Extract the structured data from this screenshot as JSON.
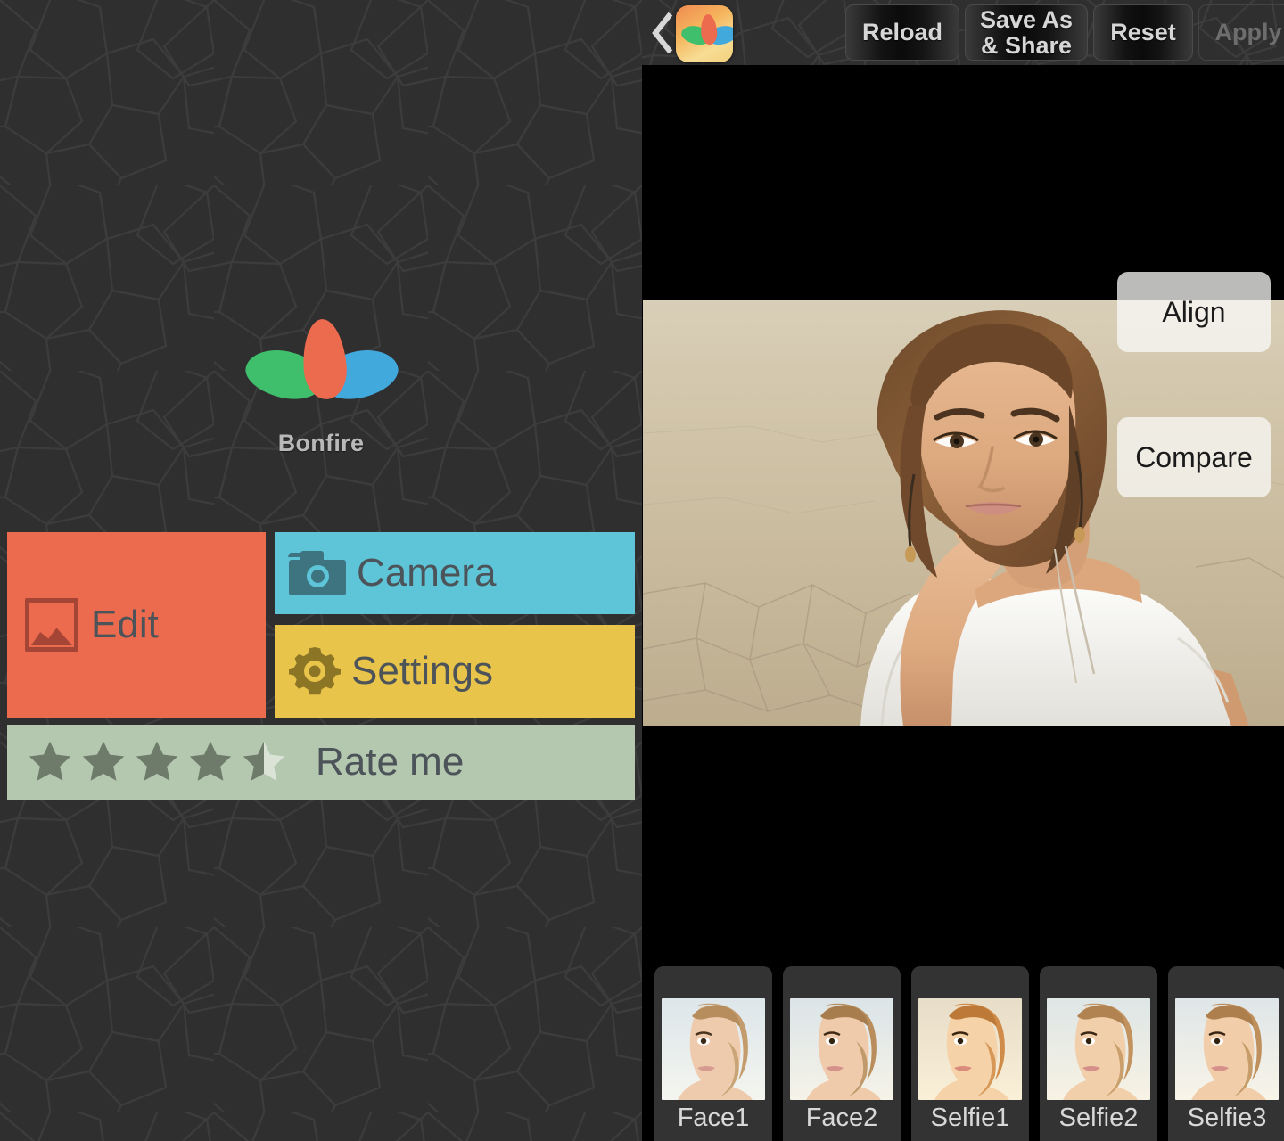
{
  "app": {
    "name": "Bonfire",
    "logo_icon": "three-leaf-logo",
    "logo_colors": {
      "orange": "#ec6a4e",
      "green": "#3fbf6b",
      "blue": "#42a9dd"
    }
  },
  "left_panel": {
    "tiles": [
      {
        "id": "edit",
        "label": "Edit",
        "icon": "picture-icon",
        "bg": "#ec6a4e",
        "icon_color": "#a54535"
      },
      {
        "id": "camera",
        "label": "Camera",
        "icon": "camera-icon",
        "bg": "#5ec5d8",
        "icon_color": "#3d7480"
      },
      {
        "id": "settings",
        "label": "Settings",
        "icon": "gear-icon",
        "bg": "#e9c44a",
        "icon_color": "#8d7526"
      }
    ],
    "rate": {
      "label": "Rate me",
      "bg": "#b4c8b0",
      "stars_filled": 4,
      "half_star": true,
      "stars_total": 5,
      "rating": 4.5,
      "star_color": "#6e7a6a",
      "star_empty_color": "#dbe3d6"
    }
  },
  "right_panel": {
    "toolbar": {
      "back_icon": "back-chevron-icon",
      "app_icon": "app-logo-icon",
      "buttons": [
        {
          "id": "reload",
          "label": "Reload",
          "enabled": true
        },
        {
          "id": "save_as",
          "label": "Save As\n& Share",
          "line1": "Save As",
          "line2": "& Share",
          "enabled": true
        },
        {
          "id": "reset",
          "label": "Reset",
          "enabled": true
        },
        {
          "id": "apply",
          "label": "Apply",
          "enabled": false
        }
      ]
    },
    "overlay_buttons": [
      {
        "id": "align",
        "label": "Align"
      },
      {
        "id": "compare",
        "label": "Compare"
      }
    ],
    "photo": {
      "alt": "woman-in-white-dress-sitting-on-cracked-earth",
      "letterbox_color": "#000000"
    },
    "presets": [
      {
        "id": "face1",
        "label": "Face1"
      },
      {
        "id": "face2",
        "label": "Face2"
      },
      {
        "id": "selfie1",
        "label": "Selfie1"
      },
      {
        "id": "selfie2",
        "label": "Selfie2"
      },
      {
        "id": "selfie3",
        "label": "Selfie3"
      }
    ]
  }
}
